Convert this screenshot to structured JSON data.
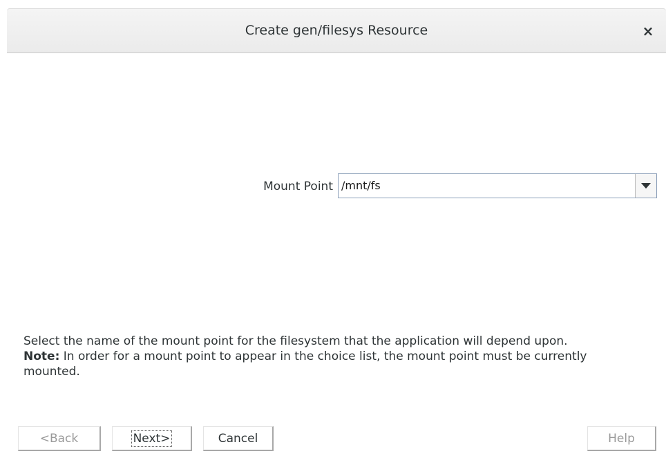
{
  "dialog": {
    "title": "Create gen/filesys Resource",
    "close_glyph": "×"
  },
  "form": {
    "mount_point_label": "Mount Point",
    "mount_point_value": "/mnt/fs",
    "dropdown_icon": "chevron-down-icon"
  },
  "help": {
    "description": "Select the name of the mount point for the filesystem that the application will depend upon.",
    "note_label": "Note:",
    "note_text": " In order for a mount point to appear in the choice list, the mount point must be currently mounted."
  },
  "buttons": {
    "back": "<Back",
    "next": "Next>",
    "cancel": "Cancel",
    "help": "Help"
  },
  "colors": {
    "titlebar": "#ebebeb",
    "combo_border": "#8a9eb8",
    "disabled_text": "#9a9a9a"
  }
}
